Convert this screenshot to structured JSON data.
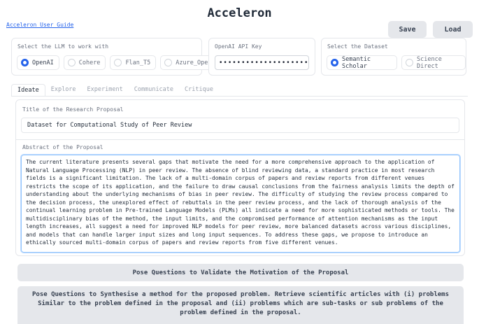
{
  "app": {
    "title": "Acceleron",
    "guide_link": "Acceleron User Guide"
  },
  "toolbar": {
    "save_label": "Save",
    "load_label": "Load"
  },
  "llm": {
    "label": "Select the LLM to work with",
    "options": [
      "OpenAI",
      "Cohere",
      "Flan_T5",
      "Azure_OpenAI"
    ],
    "selected": "OpenAI"
  },
  "api_key": {
    "label": "OpenAI API Key",
    "value": "••••••••••••••••••••••••••"
  },
  "dataset": {
    "label": "Select the Dataset",
    "options": [
      "Semantic Scholar",
      "Science Direct"
    ],
    "selected": "Semantic Scholar"
  },
  "tabs": [
    "Ideate",
    "Explore",
    "Experiment",
    "Communicate",
    "Critique"
  ],
  "active_tab": "Ideate",
  "proposal": {
    "title_label": "Title of the Research Proposal",
    "title_value": "Dataset for Computational Study of Peer Review",
    "abstract_label": "Abstract of the Proposal",
    "abstract_value": "The current literature presents several gaps that motivate the need for a more comprehensive approach to the application of Natural Language Processing (NLP) in peer review. The absence of blind reviewing data, a standard practice in most research fields is a significant limitation.  The lack of a multi-domain corpus of papers and review reports from different venues restricts the scope of its application, and the failure to draw causal conclusions from the fairness analysis limits the depth of understanding about the underlying mechanisms of bias in peer review. The difficulty of studying the review process compared to the decision process, the unexplored effect of rebuttals in the peer review process, and the lack of thorough analysis of the continual learning problem in Pre-trained Language Models (PLMs) all indicate a need for more sophisticated methods or tools. The multidisciplinary bias of the method, the input limits, and the compromised performance of attention mechanisms as the input length increases, all suggest a need for improved NLP models for peer review, more balanced datasets across various disciplines, and models that can handle larger input sizes and long input sequences. To address these gaps, we propose to introduce an ethically sourced multi-domain corpus of papers and review reports from five different venues."
  },
  "actions": {
    "validate_label": "Pose Questions to Validate the Motivation of the Proposal",
    "synthesise_label": "Pose Questions to Synthesise a method for the proposed problem. Retrieve scientific articles with (i) problems Similar to the problem defined in the proposal and (ii) problems which are sub-tasks or sub problems of the problem defined in the proposal."
  }
}
